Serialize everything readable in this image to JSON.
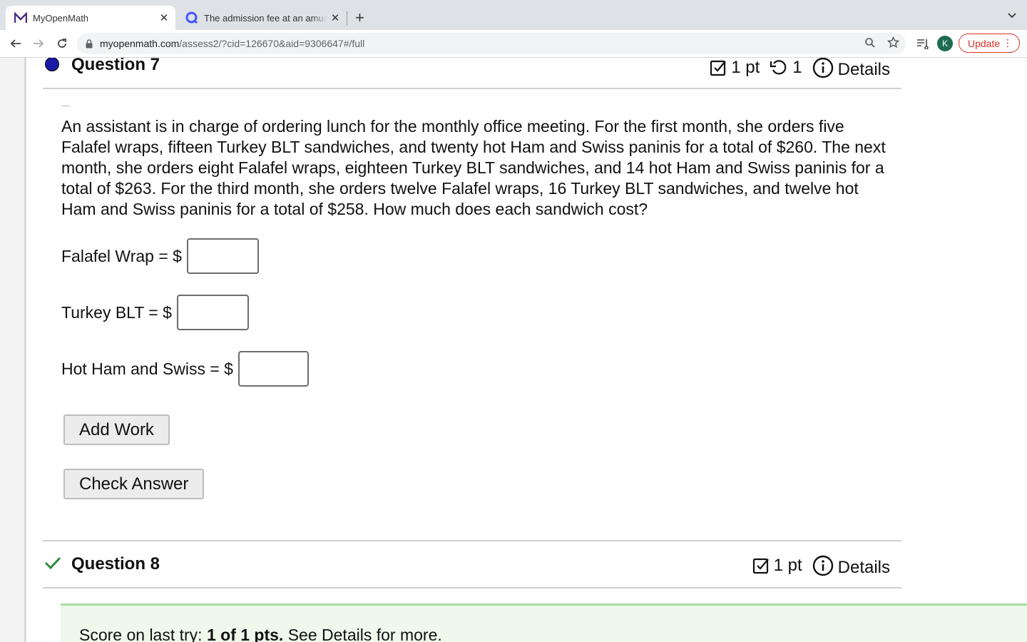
{
  "browser": {
    "tabs": [
      {
        "title": "MyOpenMath",
        "active": true,
        "icon": "myopenmath-m-icon"
      },
      {
        "title": "The admission fee at an amuse",
        "active": false,
        "icon": "quizlet-q-icon"
      }
    ],
    "new_tab": "+",
    "url": {
      "domain": "myopenmath.com",
      "path": "/assess2/?cid=126670&aid=9306647#/full"
    },
    "avatar_letter": "K",
    "update_label": "Update"
  },
  "question7": {
    "title": "Question 7",
    "points": "1 pt",
    "retries": "1",
    "details_label": "Details",
    "text": "An assistant is in charge of ordering lunch for the monthly office meeting. For the first month, she orders five Falafel wraps, fifteen Turkey BLT sandwiches, and twenty hot Ham and Swiss paninis for a total of $260. The next month, she orders eight Falafel wraps, eighteen Turkey BLT sandwiches, and 14 hot Ham and Swiss paninis for a total of $263. For the third month, she orders twelve Falafel wraps, 16 Turkey BLT sandwiches, and twelve hot Ham and Swiss paninis for a total of $258. How much does each sandwich cost?",
    "answers": [
      {
        "label": "Falafel Wrap = $",
        "value": ""
      },
      {
        "label": "Turkey BLT = $",
        "value": ""
      },
      {
        "label": "Hot Ham and Swiss = $",
        "value": ""
      }
    ],
    "add_work_label": "Add Work",
    "check_answer_label": "Check Answer"
  },
  "question8": {
    "title": "Question 8",
    "points": "1 pt",
    "details_label": "Details",
    "score_prefix": "Score on last try: ",
    "score_value": "1 of 1 pts.",
    "score_suffix": " See Details for more."
  },
  "colors": {
    "status_dot": "#1a1aa6",
    "correct_check": "#2e8b3a",
    "update_red": "#d93025",
    "score_bg": "#eef9ec"
  }
}
